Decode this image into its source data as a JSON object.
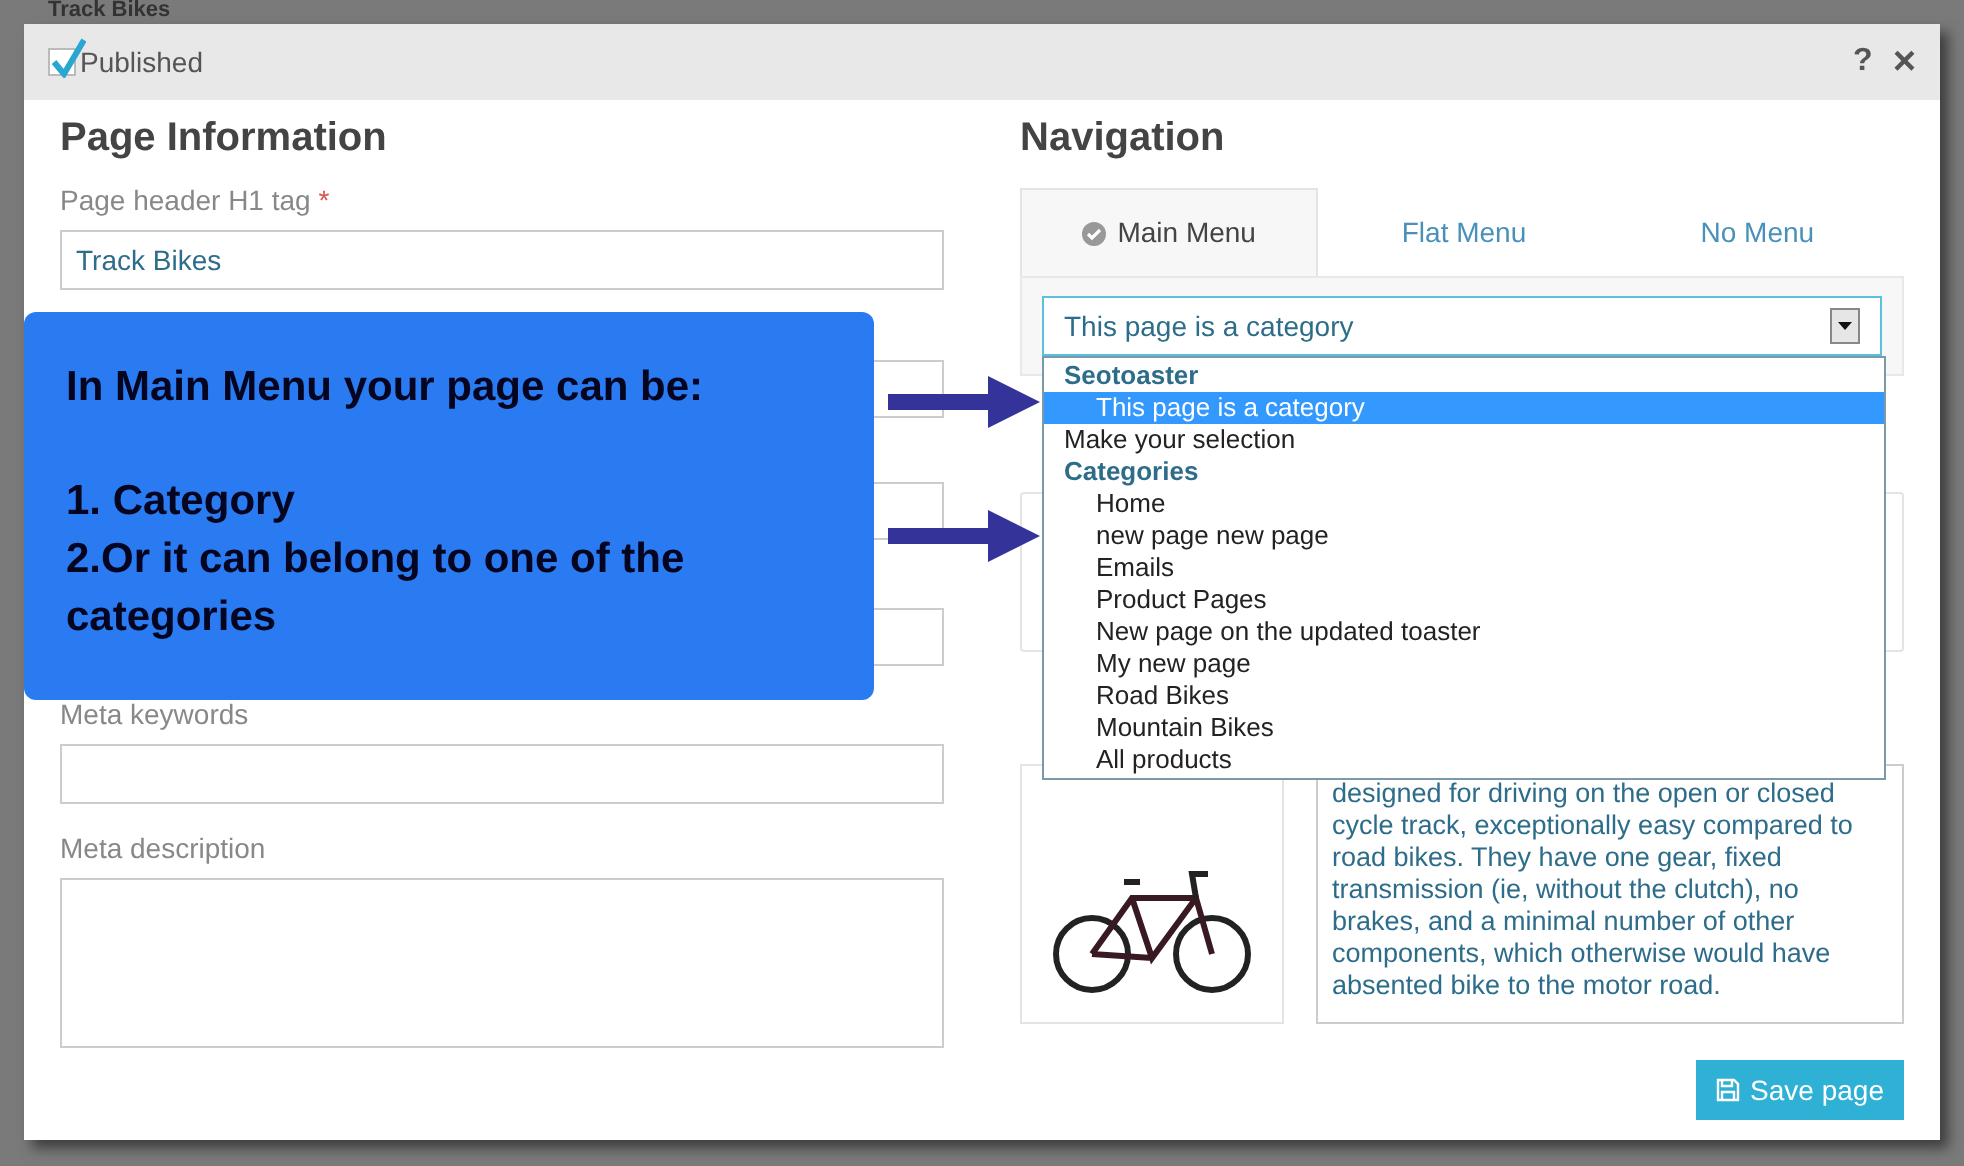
{
  "background_title": "Track Bikes",
  "dialog": {
    "published": {
      "label": "Published",
      "checked": true
    },
    "help": "?",
    "close": "×"
  },
  "page_information": {
    "title": "Page Information",
    "h1_field": {
      "label": "Page header H1 tag",
      "required_mark": "*",
      "value": "Track Bikes"
    },
    "meta_keywords": {
      "label": "Meta keywords"
    },
    "meta_description": {
      "label": "Meta description"
    }
  },
  "callout": {
    "heading": "In Main Menu your page can be:",
    "lines": [
      "1. Category",
      "2.Or it can belong to one of the categories"
    ]
  },
  "navigation": {
    "title": "Navigation",
    "tabs": [
      {
        "label": "Main Menu",
        "selected": true
      },
      {
        "label": "Flat Menu",
        "selected": false
      },
      {
        "label": "No Menu",
        "selected": false
      }
    ],
    "select_value": "This page is a category",
    "dropdown": [
      {
        "kind": "group",
        "label": "Seotoaster"
      },
      {
        "kind": "option",
        "label": "This page is a category",
        "indent": true,
        "selected": true
      },
      {
        "kind": "option",
        "label": "Make your selection",
        "indent": false,
        "selected": false
      },
      {
        "kind": "group",
        "label": "Categories"
      },
      {
        "kind": "option",
        "label": "Home",
        "indent": true,
        "selected": false
      },
      {
        "kind": "option",
        "label": "new page new page",
        "indent": true,
        "selected": false
      },
      {
        "kind": "option",
        "label": "Emails",
        "indent": true,
        "selected": false
      },
      {
        "kind": "option",
        "label": "Product Pages",
        "indent": true,
        "selected": false
      },
      {
        "kind": "option",
        "label": "New page on the updated toaster",
        "indent": true,
        "selected": false
      },
      {
        "kind": "option",
        "label": "My new page",
        "indent": true,
        "selected": false
      },
      {
        "kind": "option",
        "label": "Road Bikes",
        "indent": true,
        "selected": false
      },
      {
        "kind": "option",
        "label": "Mountain Bikes",
        "indent": true,
        "selected": false
      },
      {
        "kind": "option",
        "label": "All products",
        "indent": true,
        "selected": false
      }
    ]
  },
  "teaser_text": "designed for driving on the open or closed cycle track, exceptionally easy compared to road bikes. They have one gear, fixed transmission (ie, without the clutch), no brakes, and a minimal number of other components, which otherwise would have absented bike to the motor road.",
  "save_button": "Save page"
}
